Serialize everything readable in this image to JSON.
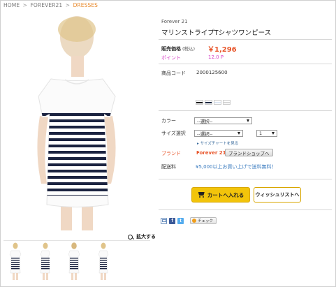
{
  "breadcrumb": {
    "home": "HOME",
    "brand": "FOREVER21",
    "current": "DRESSES",
    "separator": ">"
  },
  "product": {
    "brand": "Forever 21",
    "title": "マリンストライプTシャツワンピース",
    "price_label": "販売価格",
    "price_tax_note": "(税込)",
    "price": "￥1,296",
    "point_label": "ポイント",
    "point_value": "12.0 P",
    "code_label": "商品コード",
    "code_value": "2000125600",
    "swatch_colors": [
      "#1c1c1c",
      "#1e2a44",
      "#dde6f2",
      "#d6d6d6"
    ]
  },
  "options": {
    "color_label": "カラー",
    "color_select": "--選択--",
    "size_label": "サイズ選択",
    "size_select": "--選択--",
    "qty_select": "1",
    "size_chart_link": "▸ サイズチャートを見る"
  },
  "brand_row": {
    "label": "ブランド",
    "value": "Forever 21",
    "shop_button": "ブランドショップへ"
  },
  "shipping": {
    "label": "配送料",
    "value": "¥5,000以上お買い上げで送料無料！"
  },
  "actions": {
    "cart_button": "カートへ入れる",
    "wishlist_button": "ウィッシュリストへ",
    "zoom_label": "拡大する",
    "check_button": "チェック"
  },
  "social": {
    "icons": [
      "mail-icon",
      "facebook-icon",
      "twitter-icon"
    ],
    "facebook_letter": "f",
    "twitter_letter": "t"
  },
  "colors": {
    "accent_orange": "#e8552a",
    "breadcrumb_current": "#e8882a",
    "point_pink": "#d845c8",
    "cart_yellow": "#f2c40b",
    "link_blue": "#3a7bbf"
  }
}
